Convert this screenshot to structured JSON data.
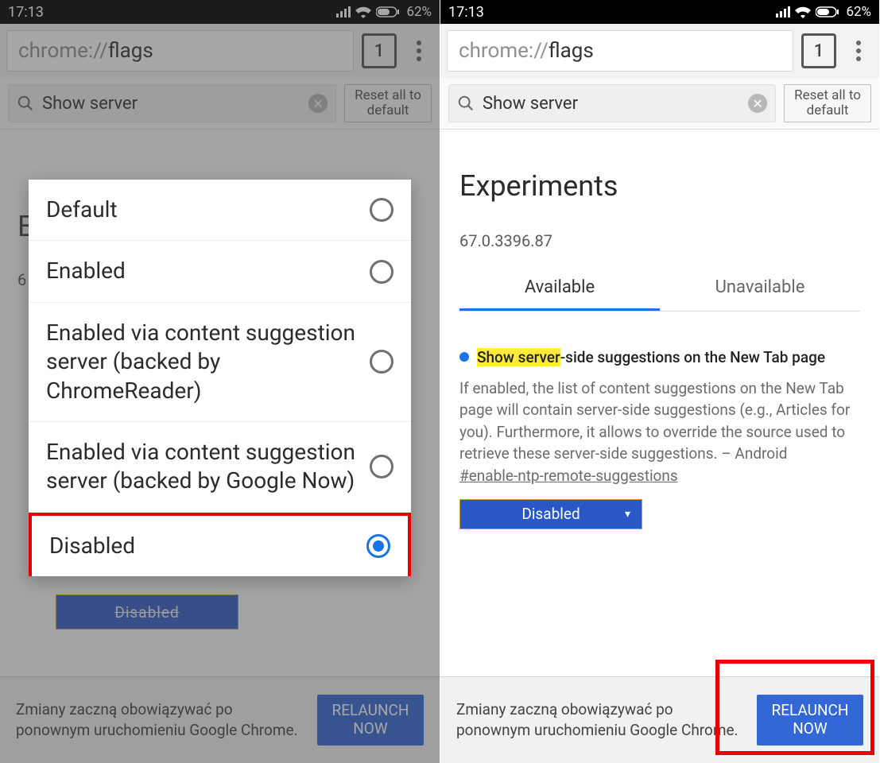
{
  "status": {
    "time": "17:13",
    "battery_pct": "62%"
  },
  "addrbar": {
    "scheme": "chrome://",
    "path": "flags",
    "tab_count": "1"
  },
  "search": {
    "query": "Show server",
    "reset_label_l1": "Reset all to",
    "reset_label_l2": "default"
  },
  "page": {
    "title": "Experiments",
    "version": "67.0.3396.87",
    "tab_available": "Available",
    "tab_unavailable": "Unavailable"
  },
  "flag": {
    "highlight": "Show server",
    "title_rest": "-side suggestions on the New Tab page",
    "desc": "If enabled, the list of content suggestions on the New Tab page will contain server-side suggestions (e.g., Articles for you). Furthermore, it allows to override the source used to retrieve these server-side suggestions. – Android",
    "hash": "#enable-ntp-remote-suggestions",
    "dropdown_value": "Disabled"
  },
  "relaunch": {
    "text": "Zmiany zaczną obowiązywać po ponownym uruchomieniu Google Chrome.",
    "button": "RELAUNCH NOW"
  },
  "dialog": {
    "opt0": "Default",
    "opt1": "Enabled",
    "opt2": "Enabled via content suggestion server (backed by ChromeReader)",
    "opt3": "Enabled via content suggestion server (backed by Google Now)",
    "opt4": "Disabled"
  },
  "left_bg": {
    "title_initial": "E",
    "version_initial": "6",
    "dd_text": "Disabled"
  }
}
